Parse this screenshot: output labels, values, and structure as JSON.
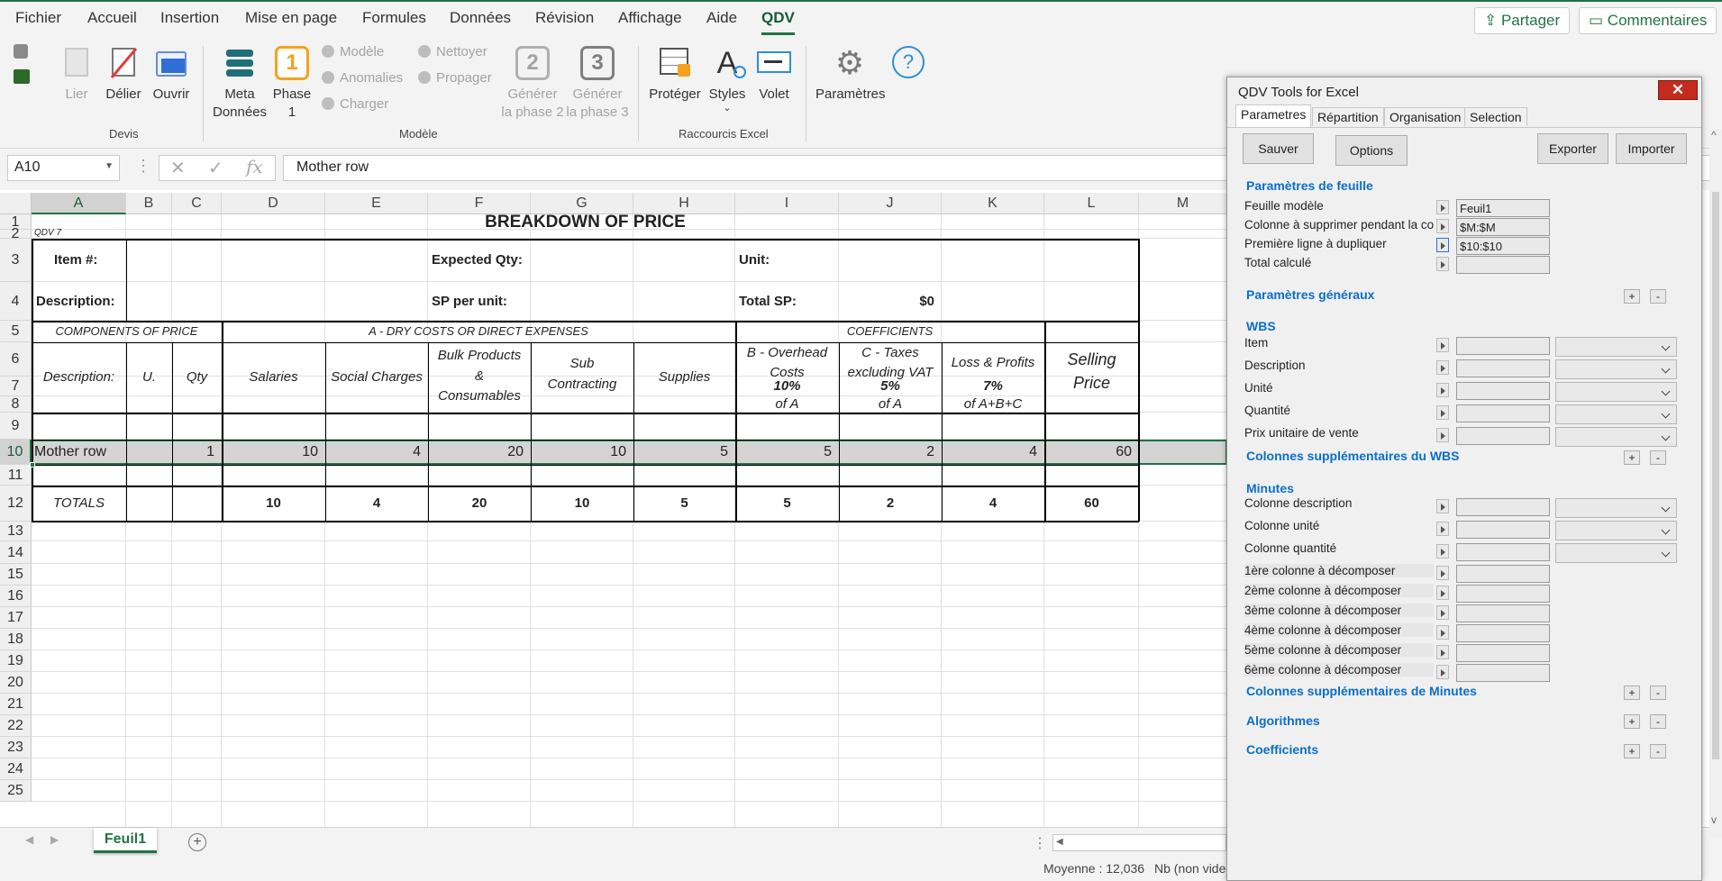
{
  "menu": {
    "items": [
      "Fichier",
      "Accueil",
      "Insertion",
      "Mise en page",
      "Formules",
      "Données",
      "Révision",
      "Affichage",
      "Aide",
      "QDV"
    ],
    "share": "Partager",
    "comments": "Commentaires"
  },
  "ribbon": {
    "lier": "Lier",
    "delier": "Délier",
    "ouvrir": "Ouvrir",
    "meta": "Meta",
    "donnees": "Données",
    "phase": "Phase",
    "phase_num": "1",
    "modele": "Modèle",
    "anomalies": "Anomalies",
    "charger": "Charger",
    "nettoyer": "Nettoyer",
    "propager": "Propager",
    "gen2_num": "2",
    "gen3_num": "3",
    "generer": "Générer",
    "phase2": "la phase 2",
    "phase3": "la phase 3",
    "proteger": "Protéger",
    "styles": "Styles",
    "volet": "Volet",
    "parametres": "Paramètres",
    "group_devis": "Devis",
    "group_modele": "Modèle",
    "group_raccourcis": "Raccourcis Excel"
  },
  "formula": {
    "cell_ref": "A10",
    "value": "Mother row"
  },
  "sheet": {
    "columns": [
      "A",
      "B",
      "C",
      "D",
      "E",
      "F",
      "G",
      "H",
      "I",
      "J",
      "K",
      "L",
      "M"
    ],
    "rows": [
      "1",
      "2",
      "3",
      "4",
      "5",
      "6",
      "7",
      "8",
      "9",
      "10",
      "11",
      "12",
      "13",
      "14",
      "15",
      "16",
      "17",
      "18",
      "19",
      "20",
      "21",
      "22",
      "23",
      "24",
      "25"
    ],
    "title": "BREAKDOWN OF PRICE",
    "qdv": "QDV 7",
    "item": "Item #:",
    "expected": "Expected Qty:",
    "unit": "Unit:",
    "description": "Description:",
    "sp_per_unit": "SP per unit:",
    "total_sp": "Total SP:",
    "total_sp_value": "$0",
    "components": "COMPONENTS OF PRICE",
    "dry_costs": "A - DRY COSTS OR DIRECT EXPENSES",
    "coefficients": "COEFFICIENTS",
    "h_desc": "Description:",
    "h_u": "U.",
    "h_qty": "Qty",
    "h_salaries": "Salaries",
    "h_social": "Social Charges",
    "h_bulk1": "Bulk Products",
    "h_bulk2": "&",
    "h_bulk3": "Consumables",
    "h_sub1": "Sub",
    "h_sub2": "Contracting",
    "h_supplies": "Supplies",
    "h_b1": "B - Overhead",
    "h_b2": "Costs",
    "h_b3": "10%",
    "h_b4": "of A",
    "h_c1": "C - Taxes",
    "h_c2": "excluding VAT",
    "h_c3": "5%",
    "h_c4": "of A",
    "h_lp1": "Loss & Profits",
    "h_lp3": "7%",
    "h_lp4": "of A+B+C",
    "h_sell1": "Selling",
    "h_sell2": "Price",
    "mother": {
      "label": "Mother row",
      "qty": "1",
      "salaries": "10",
      "social": "4",
      "bulk": "20",
      "sub": "10",
      "supplies": "5",
      "overhead": "5",
      "taxes": "2",
      "loss": "4",
      "selling": "60"
    },
    "totals": {
      "label": "TOTALS",
      "salaries": "10",
      "social": "4",
      "bulk": "20",
      "sub": "10",
      "supplies": "5",
      "overhead": "5",
      "taxes": "2",
      "loss": "4",
      "selling": "60"
    }
  },
  "tabs": {
    "sheet1": "Feuil1"
  },
  "status": {
    "average": "Moyenne : 12,036",
    "count": "Nb (non vides"
  },
  "panel": {
    "title": "QDV Tools for Excel",
    "close": "✕",
    "tabs": [
      "Parametres",
      "Répartition",
      "Organisation",
      "Selection"
    ],
    "sauver": "Sauver",
    "options": "Options",
    "exporter": "Exporter",
    "importer": "Importer",
    "sec_feuille": "Paramètres de feuille",
    "feuille_modele": "Feuille modèle",
    "feuille_modele_val": "Feuil1",
    "col_supprimer": "Colonne à supprimer pendant la co",
    "col_supprimer_val": "$M:$M",
    "premiere_ligne": "Première ligne à dupliquer",
    "premiere_ligne_val": "$10:$10",
    "total_calcule": "Total calculé",
    "sec_generaux": "Paramètres généraux",
    "sec_wbs": "WBS",
    "wbs_item": "Item",
    "wbs_desc": "Description",
    "wbs_unite": "Unité",
    "wbs_qte": "Quantité",
    "wbs_prix": "Prix unitaire de vente",
    "sec_wbs_sup": "Colonnes supplémentaires du WBS",
    "sec_minutes": "Minutes",
    "min_desc": "Colonne description",
    "min_unite": "Colonne unité",
    "min_qte": "Colonne quantité",
    "dec1": "1ère colonne à décomposer",
    "dec2": "2ème colonne à décomposer",
    "dec3": "3ème colonne à décomposer",
    "dec4": "4ème colonne à décomposer",
    "dec5": "5ème colonne à décomposer",
    "dec6": "6ème colonne à décomposer",
    "sec_min_sup": "Colonnes supplémentaires de Minutes",
    "sec_algo": "Algorithmes",
    "sec_coef": "Coefficients",
    "plus": "+",
    "minus": "-"
  }
}
